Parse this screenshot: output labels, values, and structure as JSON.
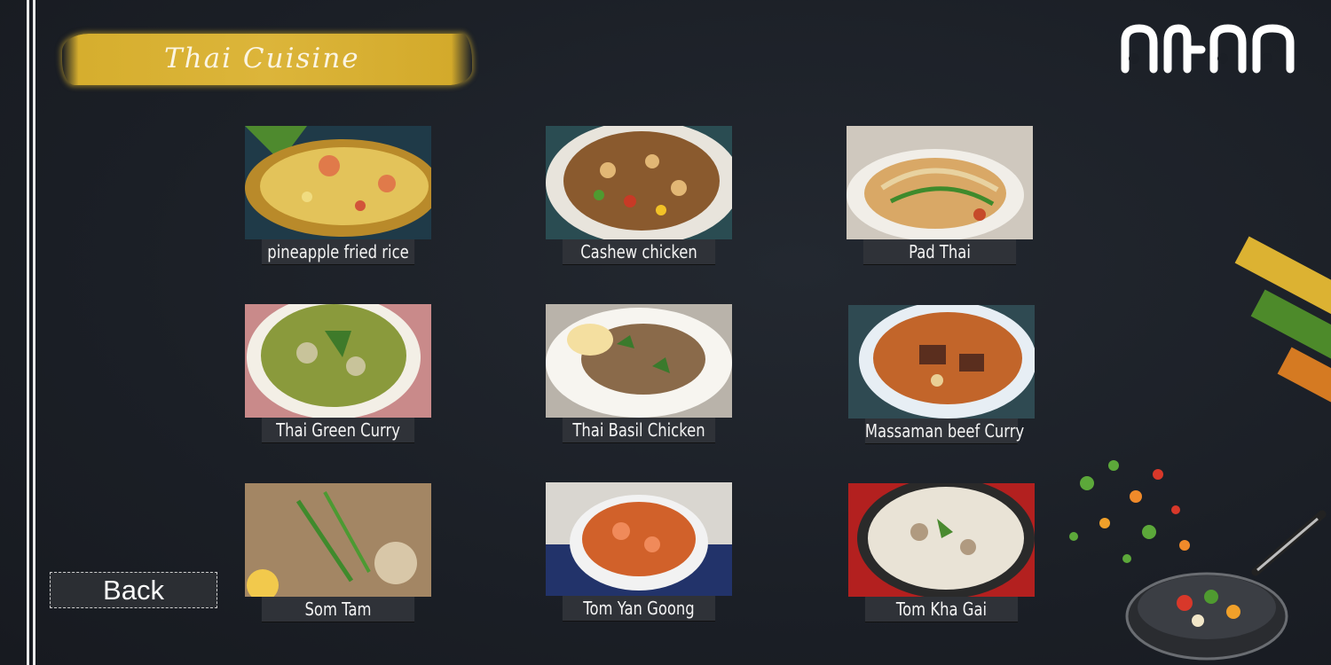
{
  "header": {
    "title": "Thai Cuisine",
    "logo_text": "สามอร"
  },
  "menu": {
    "items": [
      {
        "label": "pineapple fried rice"
      },
      {
        "label": "Cashew chicken"
      },
      {
        "label": "Pad Thai"
      },
      {
        "label": "Thai Green Curry"
      },
      {
        "label": "Thai Basil Chicken"
      },
      {
        "label": "Massaman beef Curry"
      },
      {
        "label": "Som Tam"
      },
      {
        "label": "Tom Yan Goong"
      },
      {
        "label": "Tom Kha Gai"
      }
    ]
  },
  "nav": {
    "back_label": "Back"
  },
  "colors": {
    "accent_yellow": "#d6ae2e",
    "accent_green": "#4d8a2a",
    "accent_orange": "#d57a22",
    "background": "#1b1f26"
  }
}
